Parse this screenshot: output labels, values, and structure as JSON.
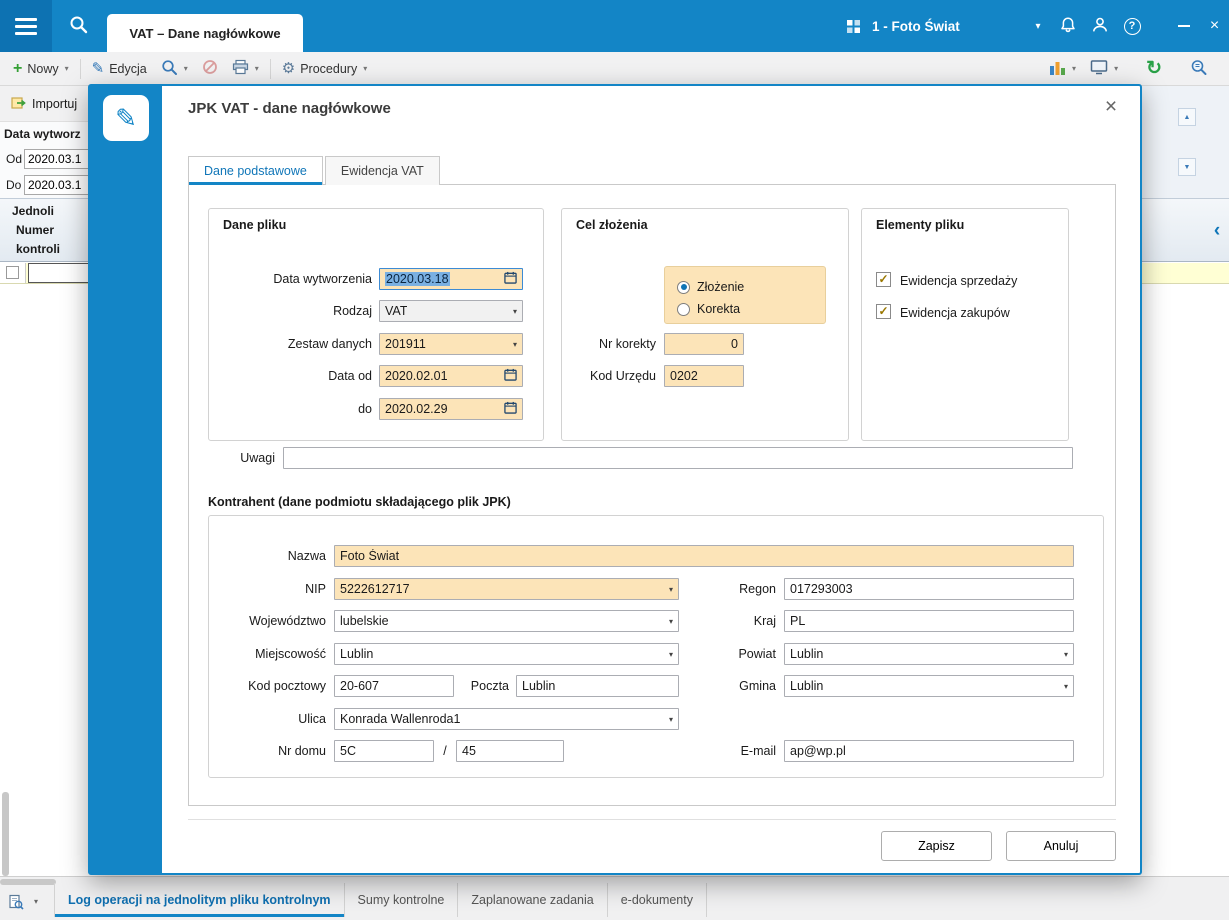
{
  "colors": {
    "accent_blue": "#1385c6",
    "tab_text_blue": "#1076b8",
    "field_amber": "#fce4b8",
    "row_yellow": "#ffffd4"
  },
  "icons": {
    "chevron_down": "▾",
    "plus": "+",
    "pencil": "✎",
    "gear": "⚙",
    "refresh": "↻",
    "close": "×",
    "question": "?",
    "check": "✓",
    "arrow_up": "▲",
    "arrow_down": "▼",
    "collapse_left": "‹"
  },
  "topbar": {
    "tab": "VAT – Dane nagłówkowe",
    "company": "1 - Foto Świat"
  },
  "toolbar": {
    "nowy": "Nowy",
    "edycja": "Edycja",
    "procedury": "Procedury"
  },
  "background": {
    "importuj": "Importuj",
    "data_wytworzenia_label": "Data wytworz",
    "od_label": "Od",
    "od_value": "2020.03.1",
    "do_label": "Do",
    "do_value": "2020.03.1",
    "header_line1": "Jednoli",
    "header_line2": "Numer",
    "header_line3": "kontroli"
  },
  "dialog": {
    "title": "JPK VAT - dane nagłówkowe",
    "tabs": [
      {
        "label": "Dane podstawowe"
      },
      {
        "label": "Ewidencja VAT"
      }
    ],
    "dane_pliku": {
      "title": "Dane pliku",
      "data_wytworzenia_label": "Data wytworzenia",
      "data_wytworzenia_value": "2020.03.18",
      "rodzaj_label": "Rodzaj",
      "rodzaj_value": "VAT",
      "zestaw_label": "Zestaw danych",
      "zestaw_value": "201911",
      "data_od_label": "Data od",
      "data_od_value": "2020.02.01",
      "do_label": "do",
      "do_value": "2020.02.29"
    },
    "cel_zlozenia": {
      "title": "Cel złożenia",
      "zlozenie": "Złożenie",
      "korekta": "Korekta",
      "nr_korekty_label": "Nr korekty",
      "nr_korekty_value": "0",
      "kod_urzedu_label": "Kod Urzędu",
      "kod_urzedu_value": "0202"
    },
    "elementy_pliku": {
      "title": "Elementy pliku",
      "ewidencja_sprzedazy": "Ewidencja sprzedaży",
      "ewidencja_zakupow": "Ewidencja zakupów"
    },
    "uwagi_label": "Uwagi",
    "uwagi_value": "",
    "kontrahent": {
      "title": "Kontrahent (dane podmiotu składającego plik JPK)",
      "nazwa_label": "Nazwa",
      "nazwa_value": "Foto Świat",
      "nip_label": "NIP",
      "nip_value": "5222612717",
      "regon_label": "Regon",
      "regon_value": "017293003",
      "wojewodztwo_label": "Województwo",
      "wojewodztwo_value": "lubelskie",
      "kraj_label": "Kraj",
      "kraj_value": "PL",
      "miejscowosc_label": "Miejscowość",
      "miejscowosc_value": "Lublin",
      "powiat_label": "Powiat",
      "powiat_value": "Lublin",
      "kod_pocztowy_label": "Kod pocztowy",
      "kod_pocztowy_value": "20-607",
      "poczta_label": "Poczta",
      "poczta_value": "Lublin",
      "gmina_label": "Gmina",
      "gmina_value": "Lublin",
      "ulica_label": "Ulica",
      "ulica_value": "Konrada Wallenroda1",
      "nr_domu_label": "Nr domu",
      "nr_domu_value": "5C",
      "separator": "/",
      "nr_lokalu_value": "45",
      "email_label": "E-mail",
      "email_value": "ap@wp.pl"
    },
    "zapisz": "Zapisz",
    "anuluj": "Anuluj"
  },
  "bottombar": {
    "tabs": [
      {
        "label": "Log operacji na jednolitym pliku kontrolnym"
      },
      {
        "label": "Sumy kontrolne"
      },
      {
        "label": "Zaplanowane zadania"
      },
      {
        "label": "e-dokumenty"
      }
    ]
  }
}
